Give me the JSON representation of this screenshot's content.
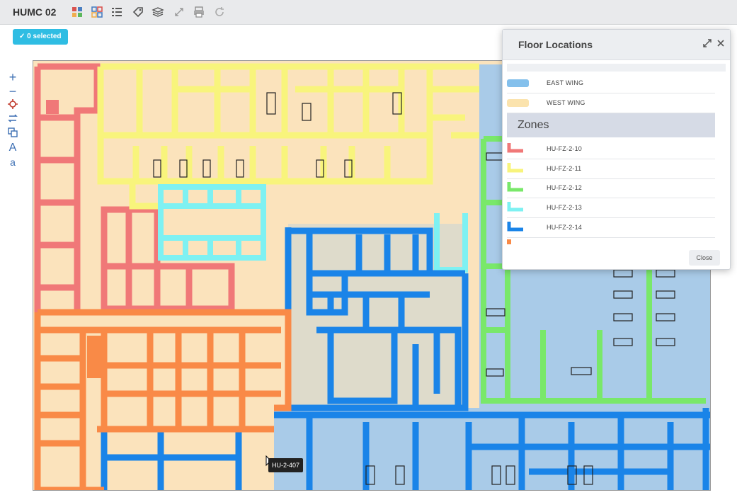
{
  "header": {
    "title": "HUMC 02",
    "tools": [
      "grid-view-icon",
      "grid-select-icon",
      "list-icon",
      "tag-icon",
      "layers-icon",
      "expand-icon",
      "print-icon",
      "refresh-icon"
    ]
  },
  "selection": {
    "label": "0 selected",
    "color": "#2fbde3"
  },
  "left_tools": [
    "zoom-in-icon",
    "zoom-out-icon",
    "pan-target-icon",
    "move-icon",
    "copy-icon",
    "text-large-icon",
    "text-small-icon"
  ],
  "left_tools_glyphs": {
    "text_large": "A",
    "text_small": "a"
  },
  "map": {
    "tooltip": "HU-2-407",
    "colors": {
      "base": "#fbe3bc",
      "east": "#a9cbe8",
      "z10": "#f07878",
      "z11": "#f8f47c",
      "z12": "#79e86a",
      "z13": "#7ef1f2",
      "z14": "#1a84e8",
      "orange": "#f98a47"
    }
  },
  "panel": {
    "title": "Floor Locations",
    "locations": [
      {
        "label": "EAST WING",
        "color": "#84c0ec"
      },
      {
        "label": "WEST WING",
        "color": "#fbe3ad"
      }
    ],
    "zones_title": "Zones",
    "zones": [
      {
        "label": "HU-FZ-2-10",
        "color": "#f07878"
      },
      {
        "label": "HU-FZ-2-11",
        "color": "#f8f47c"
      },
      {
        "label": "HU-FZ-2-12",
        "color": "#79e86a"
      },
      {
        "label": "HU-FZ-2-13",
        "color": "#7ef1f2"
      },
      {
        "label": "HU-FZ-2-14",
        "color": "#1a84e8"
      }
    ],
    "extra_zone_color": "#f98a47",
    "close_label": "Close"
  }
}
